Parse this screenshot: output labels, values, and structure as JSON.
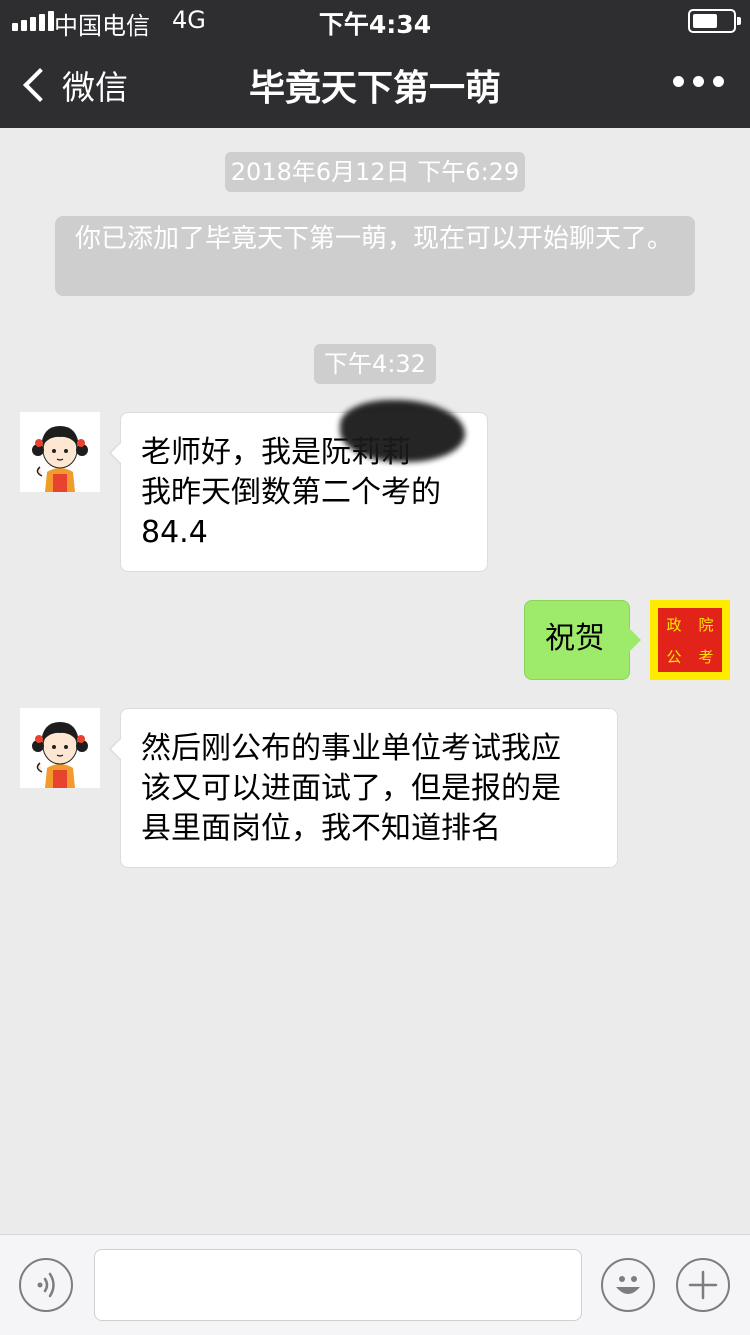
{
  "status_bar": {
    "carrier": "中国电信",
    "network": "4G",
    "time": "下午4:34",
    "battery_level": 0.55
  },
  "nav": {
    "back_label": "微信",
    "title": "毕竟天下第一萌"
  },
  "messages": {
    "timestamp_1": "2018年6月12日 下午6:29",
    "system_notice": "你已添加了毕竟天下第一萌，现在可以开始聊天了。",
    "timestamp_2": "下午4:32",
    "incoming_1": [
      "老师好，我是阮莉莉",
      "我昨天倒数第二个考的",
      "84.4"
    ],
    "outgoing_1": "祝贺",
    "stamp_chars": [
      "政",
      "院",
      "公",
      "考"
    ],
    "incoming_2": [
      "然后刚公布的事业单位考试我应",
      "该又可以进面试了，但是报的是",
      "县里面岗位，我不知道排名"
    ]
  },
  "icons": {
    "back": "chevron-left-icon",
    "more": "more-dots-icon",
    "voice": "voice-icon",
    "emoji": "emoji-icon",
    "add": "plus-icon"
  },
  "colors": {
    "header_bg": "#2e2e30",
    "chat_bg": "#ebebeb",
    "outgoing_bubble": "#9eea6a",
    "incoming_bubble": "#ffffff"
  }
}
